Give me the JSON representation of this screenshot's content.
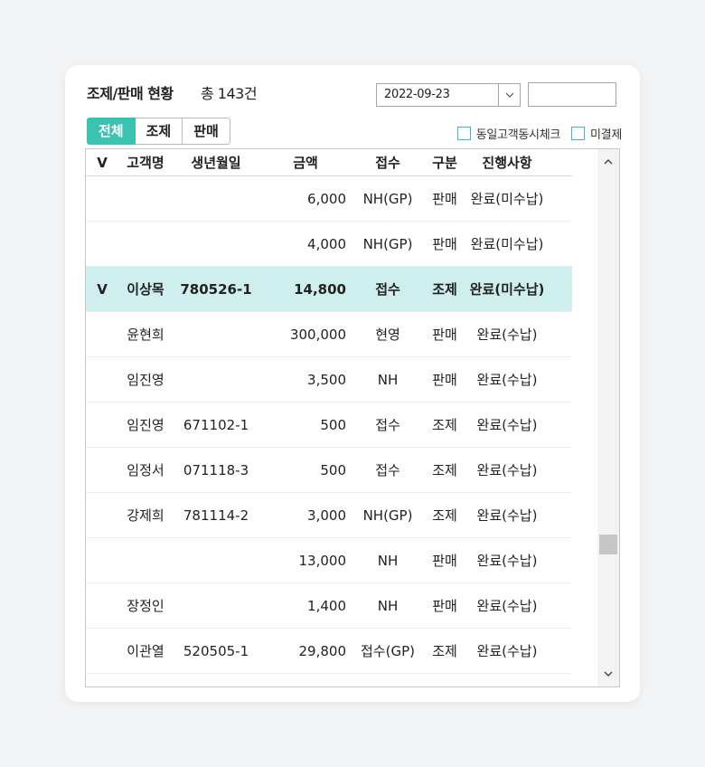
{
  "header": {
    "title": "조제/판매 현황",
    "count": "총 143건"
  },
  "date": {
    "value": "2022-09-23",
    "dropdown_icon": "chevron-down"
  },
  "tabs": [
    {
      "label": "전체",
      "active": true
    },
    {
      "label": "조제",
      "active": false
    },
    {
      "label": "판매",
      "active": false
    }
  ],
  "filters": {
    "same_customer_label": "동일고객동시체크",
    "unsettled_label": "미결제"
  },
  "table": {
    "columns": [
      "V",
      "고객명",
      "생년월일",
      "금액",
      "접수",
      "구분",
      "진행사항"
    ],
    "rows": [
      {
        "v": "",
        "name": "",
        "birth": "",
        "amount": "6,000",
        "reception": "NH(GP)",
        "type": "판매",
        "status": "완료(미수납)"
      },
      {
        "v": "",
        "name": "",
        "birth": "",
        "amount": "4,000",
        "reception": "NH(GP)",
        "type": "판매",
        "status": "완료(미수납)"
      },
      {
        "v": "V",
        "name": "이상목",
        "birth": "780526-1",
        "amount": "14,800",
        "reception": "접수",
        "type": "조제",
        "status": "완료(미수납)"
      },
      {
        "v": "",
        "name": "윤현희",
        "birth": "",
        "amount": "300,000",
        "reception": "현영",
        "type": "판매",
        "status": "완료(수납)"
      },
      {
        "v": "",
        "name": "임진영",
        "birth": "",
        "amount": "3,500",
        "reception": "NH",
        "type": "판매",
        "status": "완료(수납)"
      },
      {
        "v": "",
        "name": "임진영",
        "birth": "671102-1",
        "amount": "500",
        "reception": "접수",
        "type": "조제",
        "status": "완료(수납)"
      },
      {
        "v": "",
        "name": "임정서",
        "birth": "071118-3",
        "amount": "500",
        "reception": "접수",
        "type": "조제",
        "status": "완료(수납)"
      },
      {
        "v": "",
        "name": "강제희",
        "birth": "781114-2",
        "amount": "3,000",
        "reception": "NH(GP)",
        "type": "조제",
        "status": "완료(수납)"
      },
      {
        "v": "",
        "name": "",
        "birth": "",
        "amount": "13,000",
        "reception": "NH",
        "type": "판매",
        "status": "완료(수납)"
      },
      {
        "v": "",
        "name": "장정인",
        "birth": "",
        "amount": "1,400",
        "reception": "NH",
        "type": "판매",
        "status": "완료(수납)"
      },
      {
        "v": "",
        "name": "이관열",
        "birth": "520505-1",
        "amount": "29,800",
        "reception": "접수(GP)",
        "type": "조제",
        "status": "완료(수납)"
      }
    ],
    "selected_row": 2
  },
  "colors": {
    "accent": "#3bc2b0",
    "selected_row": "#cfeeee",
    "checkbox_border": "#39b4d6"
  }
}
